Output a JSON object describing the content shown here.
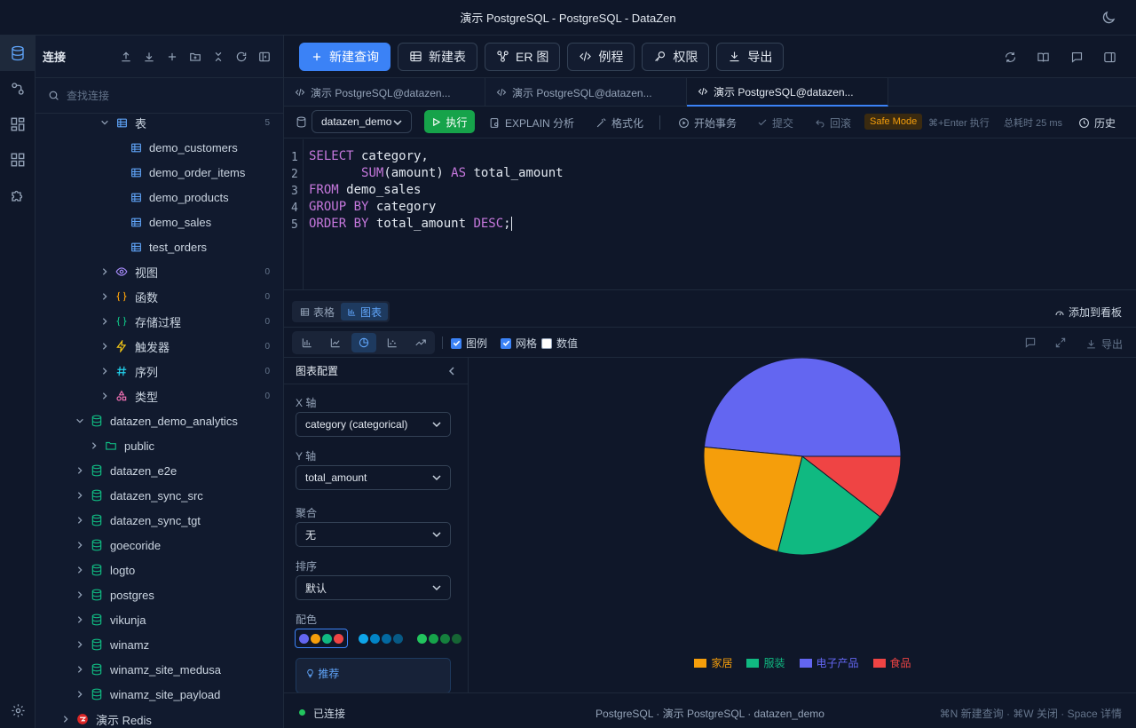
{
  "window": {
    "title": "演示 PostgreSQL - PostgreSQL - DataZen"
  },
  "sidebar": {
    "title": "连接",
    "search_placeholder": "查找连接",
    "tree": [
      {
        "label": "表",
        "count": "5",
        "level": 4,
        "icon": "table-icon",
        "chev": "down",
        "color": "#60a5fa"
      },
      {
        "label": "demo_customers",
        "level": 5,
        "icon": "table-icon",
        "color": "#60a5fa"
      },
      {
        "label": "demo_order_items",
        "level": 5,
        "icon": "table-icon",
        "color": "#60a5fa"
      },
      {
        "label": "demo_products",
        "level": 5,
        "icon": "table-icon",
        "color": "#60a5fa"
      },
      {
        "label": "demo_sales",
        "level": 5,
        "icon": "table-icon",
        "color": "#60a5fa"
      },
      {
        "label": "test_orders",
        "level": 5,
        "icon": "table-icon",
        "color": "#60a5fa"
      },
      {
        "label": "视图",
        "count": "0",
        "level": 4,
        "icon": "eye-icon",
        "chev": "right",
        "color": "#a78bfa"
      },
      {
        "label": "函数",
        "count": "0",
        "level": 4,
        "icon": "braces-icon",
        "chev": "right",
        "color": "#f59e0b"
      },
      {
        "label": "存储过程",
        "count": "0",
        "level": 4,
        "icon": "braces-icon",
        "chev": "right",
        "color": "#10b981"
      },
      {
        "label": "触发器",
        "count": "0",
        "level": 4,
        "icon": "bolt-icon",
        "chev": "right",
        "color": "#facc15"
      },
      {
        "label": "序列",
        "count": "0",
        "level": 4,
        "icon": "hash-icon",
        "chev": "right",
        "color": "#22d3ee"
      },
      {
        "label": "类型",
        "count": "0",
        "level": 4,
        "icon": "shapes-icon",
        "chev": "right",
        "color": "#f472b6"
      },
      {
        "label": "datazen_demo_analytics",
        "level": 2,
        "icon": "database-icon",
        "chev": "down",
        "color": "#10b981"
      },
      {
        "label": "public",
        "level": 3,
        "icon": "folder-icon",
        "chev": "right",
        "color": "#10b981"
      },
      {
        "label": "datazen_e2e",
        "level": 2,
        "icon": "database-icon",
        "chev": "right",
        "color": "#10b981"
      },
      {
        "label": "datazen_sync_src",
        "level": 2,
        "icon": "database-icon",
        "chev": "right",
        "color": "#10b981"
      },
      {
        "label": "datazen_sync_tgt",
        "level": 2,
        "icon": "database-icon",
        "chev": "right",
        "color": "#10b981"
      },
      {
        "label": "goecoride",
        "level": 2,
        "icon": "database-icon",
        "chev": "right",
        "color": "#10b981"
      },
      {
        "label": "logto",
        "level": 2,
        "icon": "database-icon",
        "chev": "right",
        "color": "#10b981"
      },
      {
        "label": "postgres",
        "level": 2,
        "icon": "database-icon",
        "chev": "right",
        "color": "#10b981"
      },
      {
        "label": "vikunja",
        "level": 2,
        "icon": "database-icon",
        "chev": "right",
        "color": "#10b981"
      },
      {
        "label": "winamz",
        "level": 2,
        "icon": "database-icon",
        "chev": "right",
        "color": "#10b981"
      },
      {
        "label": "winamz_site_medusa",
        "level": 2,
        "icon": "database-icon",
        "chev": "right",
        "color": "#10b981"
      },
      {
        "label": "winamz_site_payload",
        "level": 2,
        "icon": "database-icon",
        "chev": "right",
        "color": "#10b981"
      },
      {
        "label": "演示 Redis",
        "level": 1,
        "icon": "redis-icon",
        "chev": "right",
        "color": "#dc2626"
      }
    ]
  },
  "toolbar": {
    "new_query": "新建查询",
    "new_table": "新建表",
    "er": "ER 图",
    "routines": "例程",
    "permissions": "权限",
    "export": "导出"
  },
  "tabs": [
    {
      "label": "演示 PostgreSQL@datazen..."
    },
    {
      "label": "演示 PostgreSQL@datazen..."
    },
    {
      "label": "演示 PostgreSQL@datazen..."
    }
  ],
  "querybar": {
    "database": "datazen_demo",
    "run": "执行",
    "explain": "EXPLAIN 分析",
    "format": "格式化",
    "begin_tx": "开始事务",
    "commit": "提交",
    "rollback": "回滚",
    "safe_mode": "Safe Mode",
    "shortcut": "⌘+Enter 执行",
    "elapsed": "总耗时 25 ms",
    "history": "历史"
  },
  "editor": {
    "line_numbers": [
      "1",
      "2",
      "3",
      "4",
      "5"
    ],
    "lines": [
      [
        {
          "t": "SELECT",
          "k": 1
        },
        {
          "t": " category,",
          "k": 0
        }
      ],
      [
        {
          "t": "       ",
          "k": 0
        },
        {
          "t": "SUM",
          "k": 1
        },
        {
          "t": "(amount) ",
          "k": 0
        },
        {
          "t": "AS",
          "k": 1
        },
        {
          "t": " total_amount",
          "k": 0
        }
      ],
      [
        {
          "t": "FROM",
          "k": 1
        },
        {
          "t": " demo_sales",
          "k": 0
        }
      ],
      [
        {
          "t": "GROUP BY",
          "k": 1
        },
        {
          "t": " category",
          "k": 0
        }
      ],
      [
        {
          "t": "ORDER BY",
          "k": 1
        },
        {
          "t": " total_amount ",
          "k": 0
        },
        {
          "t": "DESC",
          "k": 1
        },
        {
          "t": ";",
          "k": 0
        }
      ]
    ]
  },
  "result": {
    "tab_table": "表格",
    "tab_chart": "图表",
    "add_to_board": "添加到看板",
    "legend_label": "图例",
    "grid_label": "网格",
    "values_label": "数值",
    "legend_checked": true,
    "grid_checked": true,
    "values_checked": false,
    "export": "导出"
  },
  "config": {
    "title": "图表配置",
    "x_label": "X 轴",
    "x_value": "category (categorical)",
    "y_label": "Y 轴",
    "y_value": "total_amount",
    "agg_label": "聚合",
    "agg_value": "无",
    "sort_label": "排序",
    "sort_value": "默认",
    "palette_label": "配色",
    "tip": "推荐"
  },
  "chart_data": {
    "type": "pie",
    "categories": [
      "电子产品",
      "家居",
      "服装",
      "食品"
    ],
    "values": [
      48.5,
      22.5,
      18.5,
      10.5
    ],
    "colors": [
      "#6366f1",
      "#f59e0b",
      "#10b981",
      "#ef4444"
    ],
    "legend_order": [
      "家居",
      "服装",
      "电子产品",
      "食品"
    ],
    "legend_position": "bottom"
  },
  "status": {
    "connected": "已连接",
    "center": "PostgreSQL · 演示 PostgreSQL · datazen_demo",
    "right": "⌘N 新建查询 · ⌘W 关闭 · Space 详情"
  }
}
